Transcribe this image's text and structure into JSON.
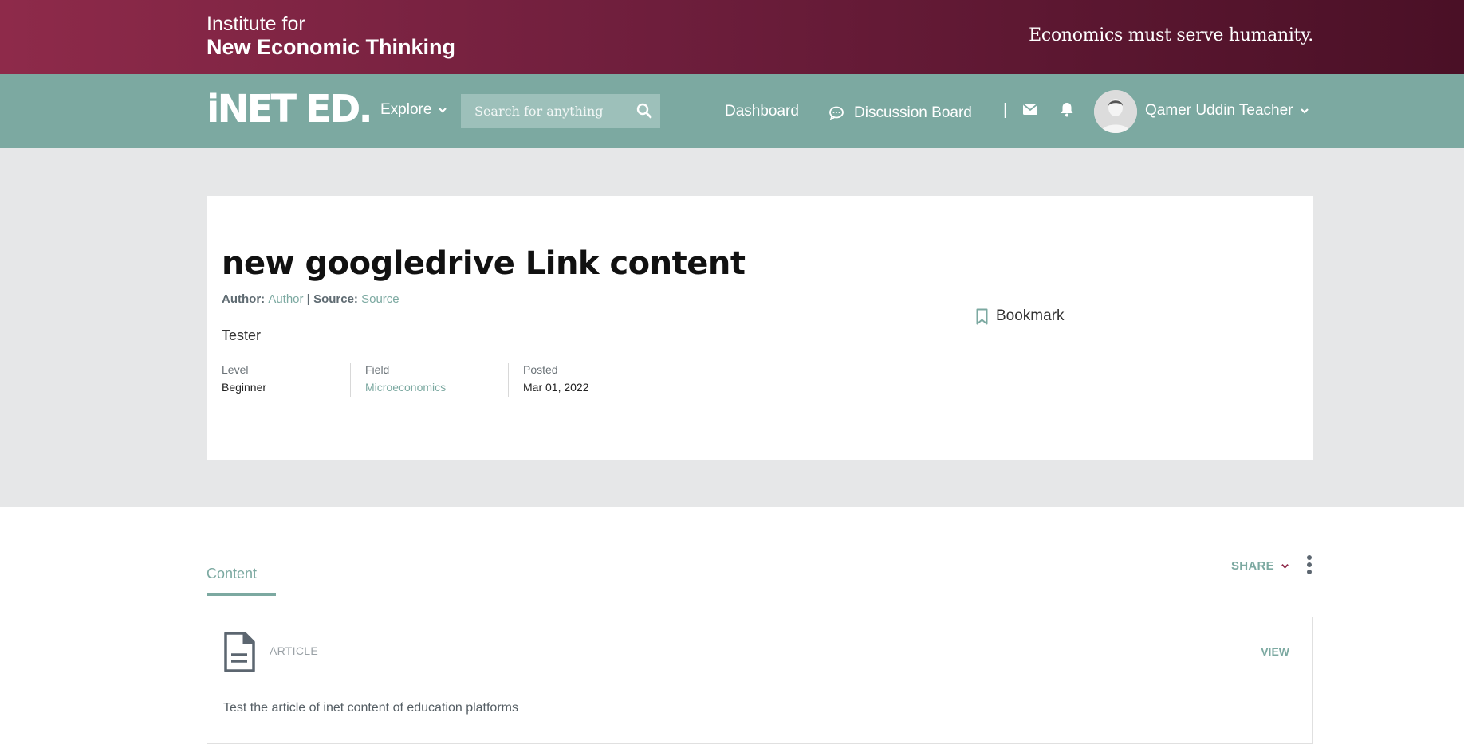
{
  "brand": {
    "logo_line1": "Institute for",
    "logo_line2": "New Economic Thinking",
    "tagline": "Economics must serve humanity."
  },
  "nav": {
    "logo": "iNET ED.",
    "explore": "Explore",
    "search_placeholder": "Search for anything",
    "dashboard": "Dashboard",
    "discussion": "Discussion Board",
    "separator": "|",
    "user_name": "Qamer Uddin Teacher"
  },
  "content": {
    "title": "new googledrive Link content",
    "author_label": "Author:",
    "author": "Author",
    "byline_sep": "|",
    "source_label": "Source:",
    "source": "Source",
    "description": "Tester",
    "bookmark": "Bookmark",
    "meta": {
      "level_label": "Level",
      "level": "Beginner",
      "field_label": "Field",
      "field": "Microeconomics",
      "posted_label": "Posted",
      "posted": "Mar 01, 2022"
    }
  },
  "tabs": {
    "content": "Content",
    "share": "SHARE"
  },
  "article": {
    "type": "ARTICLE",
    "view": "VIEW",
    "description": "Test the article of inet content of education platforms"
  },
  "colors": {
    "brand_start": "#8e2a4a",
    "brand_end": "#4a1026",
    "nav_bg": "#7ca9a1",
    "accent": "#7ca9a1",
    "hero_bg": "#e6e7e8"
  }
}
